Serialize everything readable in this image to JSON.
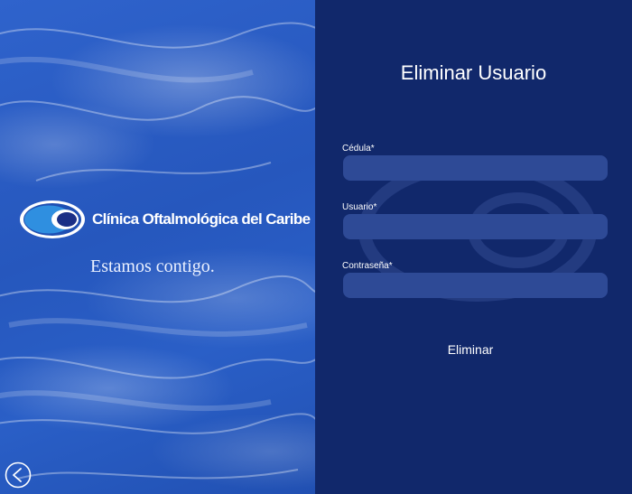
{
  "brand": {
    "name": "Clínica Oftalmológica del Caribe",
    "tagline": "Estamos contigo."
  },
  "form": {
    "title": "Eliminar Usuario",
    "fields": [
      {
        "label": "Cédula*",
        "value": "",
        "placeholder": ""
      },
      {
        "label": "Usuario*",
        "value": "",
        "placeholder": ""
      },
      {
        "label": "Contraseña*",
        "value": "",
        "placeholder": ""
      }
    ],
    "submit_label": "Eliminar"
  },
  "nav": {
    "back_icon": "chevron-left-circle-icon"
  },
  "colors": {
    "left_panel": "#2a5bc4",
    "right_panel": "#11286b",
    "field_bg": "#2e4a96",
    "text": "#ffffff"
  }
}
